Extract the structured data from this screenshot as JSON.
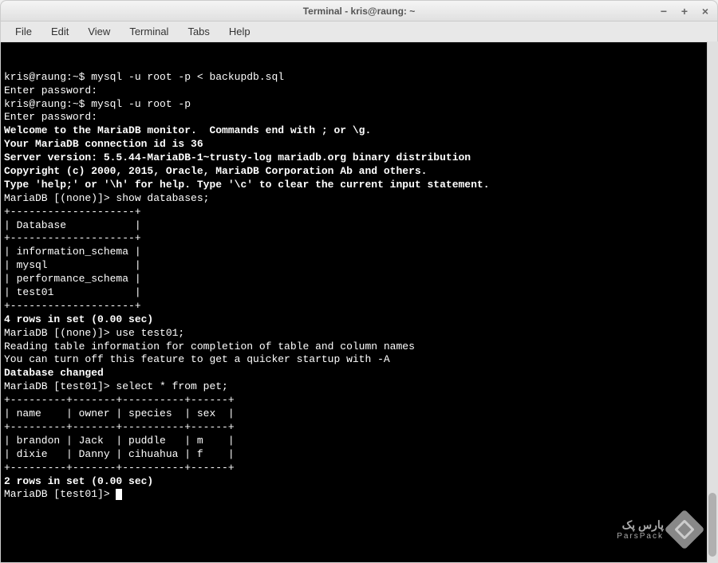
{
  "window": {
    "title": "Terminal - kris@raung: ~"
  },
  "menubar": {
    "items": [
      "File",
      "Edit",
      "View",
      "Terminal",
      "Tabs",
      "Help"
    ]
  },
  "terminal": {
    "lines": [
      {
        "text": "kris@raung:~$ mysql -u root -p < backupdb.sql",
        "bold": false
      },
      {
        "text": "Enter password:",
        "bold": false
      },
      {
        "text": "kris@raung:~$ mysql -u root -p",
        "bold": false
      },
      {
        "text": "Enter password:",
        "bold": false
      },
      {
        "text": "Welcome to the MariaDB monitor.  Commands end with ; or \\g.",
        "bold": true
      },
      {
        "text": "Your MariaDB connection id is 36",
        "bold": true
      },
      {
        "text": "Server version: 5.5.44-MariaDB-1~trusty-log mariadb.org binary distribution",
        "bold": true
      },
      {
        "text": "",
        "bold": false
      },
      {
        "text": "Copyright (c) 2000, 2015, Oracle, MariaDB Corporation Ab and others.",
        "bold": true
      },
      {
        "text": "",
        "bold": false
      },
      {
        "text": "Type 'help;' or '\\h' for help. Type '\\c' to clear the current input statement.",
        "bold": true
      },
      {
        "text": "",
        "bold": false
      },
      {
        "text": "MariaDB [(none)]> show databases;",
        "bold": false
      },
      {
        "text": "+--------------------+",
        "bold": false
      },
      {
        "text": "| Database           |",
        "bold": false
      },
      {
        "text": "+--------------------+",
        "bold": false
      },
      {
        "text": "| information_schema |",
        "bold": false
      },
      {
        "text": "| mysql              |",
        "bold": false
      },
      {
        "text": "| performance_schema |",
        "bold": false
      },
      {
        "text": "| test01             |",
        "bold": false
      },
      {
        "text": "+--------------------+",
        "bold": false
      },
      {
        "text": "4 rows in set (0.00 sec)",
        "bold": true
      },
      {
        "text": "",
        "bold": false
      },
      {
        "text": "MariaDB [(none)]> use test01;",
        "bold": false
      },
      {
        "text": "Reading table information for completion of table and column names",
        "bold": false
      },
      {
        "text": "You can turn off this feature to get a quicker startup with -A",
        "bold": false
      },
      {
        "text": "",
        "bold": false
      },
      {
        "text": "Database changed",
        "bold": true
      },
      {
        "text": "MariaDB [test01]> select * from pet;",
        "bold": false
      },
      {
        "text": "+---------+-------+----------+------+",
        "bold": false
      },
      {
        "text": "| name    | owner | species  | sex  |",
        "bold": false
      },
      {
        "text": "+---------+-------+----------+------+",
        "bold": false
      },
      {
        "text": "| brandon | Jack  | puddle   | m    |",
        "bold": false
      },
      {
        "text": "| dixie   | Danny | cihuahua | f    |",
        "bold": false
      },
      {
        "text": "+---------+-------+----------+------+",
        "bold": false
      },
      {
        "text": "2 rows in set (0.00 sec)",
        "bold": true
      },
      {
        "text": "",
        "bold": false
      }
    ],
    "prompt": "MariaDB [test01]> "
  },
  "watermark": {
    "arabic": "پارس پک",
    "english": "ParsPack"
  }
}
